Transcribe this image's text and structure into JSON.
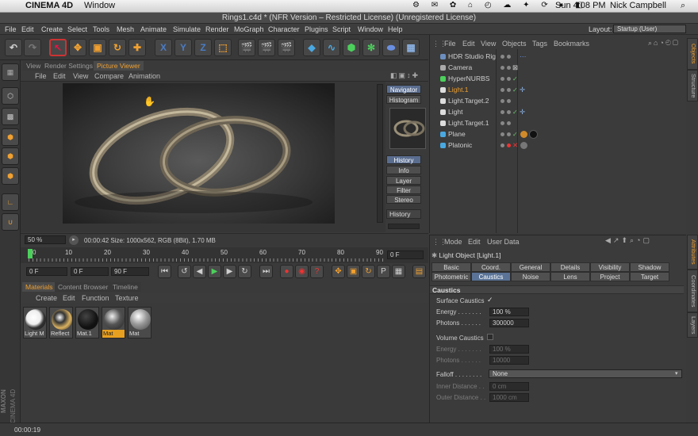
{
  "mac_menu": {
    "app": "CINEMA 4D",
    "window": "Window",
    "clock": "Sun 4:08 PM",
    "user": "Nick Campbell"
  },
  "window_title": "Rings1.c4d * (NFR Version – Restricted License) (Unregistered License)",
  "menu": [
    "File",
    "Edit",
    "Create",
    "Select",
    "Tools",
    "Mesh",
    "Animate",
    "Simulate",
    "Render",
    "MoGraph",
    "Character",
    "Plugins",
    "Script",
    "Window",
    "Help"
  ],
  "layout": {
    "label": "Layout:",
    "value": "Startup (User)"
  },
  "viewer": {
    "tabs": [
      "View",
      "Render Settings",
      "Picture Viewer"
    ],
    "menu": [
      "File",
      "Edit",
      "View",
      "Compare",
      "Animation"
    ],
    "side": [
      "Navigator",
      "Histogram"
    ],
    "side2": [
      "History",
      "Info",
      "Layer",
      "Filter",
      "Stereo"
    ],
    "history_label": "History",
    "zoom": "50 %",
    "status": "00:00:42  Size: 1000x562, RGB (8Bit), 1.70 MB"
  },
  "timeline": {
    "ticks": [
      "0",
      "10",
      "20",
      "30",
      "40",
      "50",
      "60",
      "70",
      "80",
      "90"
    ],
    "frame_end_right": "0 F",
    "start": "0 F",
    "current": "0 F",
    "end": "90 F"
  },
  "materials": {
    "tabs": [
      "Materials",
      "Content Browser",
      "Timeline"
    ],
    "menu": [
      "Create",
      "Edit",
      "Function",
      "Texture"
    ],
    "items": [
      {
        "name": "Light M",
        "c": "#eee"
      },
      {
        "name": "Reflect",
        "c": "#222"
      },
      {
        "name": "Mat.1",
        "c": "#111"
      },
      {
        "name": "Mat",
        "c": "#555"
      },
      {
        "name": "Mat",
        "c": "#888"
      }
    ]
  },
  "objects": {
    "menu": [
      "File",
      "Edit",
      "View",
      "Objects",
      "Tags",
      "Bookmarks"
    ],
    "rows": [
      {
        "name": "HDR Studio Rig",
        "hl": false
      },
      {
        "name": "Camera",
        "hl": false
      },
      {
        "name": "HyperNURBS",
        "hl": false
      },
      {
        "name": "Light.1",
        "hl": true
      },
      {
        "name": "Light.Target.2",
        "hl": false
      },
      {
        "name": "Light",
        "hl": false
      },
      {
        "name": "Light.Target.1",
        "hl": false
      },
      {
        "name": "Plane",
        "hl": false
      },
      {
        "name": "Platonic",
        "hl": false
      }
    ]
  },
  "attributes": {
    "menu": [
      "Mode",
      "Edit",
      "User Data"
    ],
    "title": "Light Object [Light.1]",
    "tabs_row1": [
      "Basic",
      "Coord.",
      "General",
      "Details",
      "Visibility",
      "Shadow"
    ],
    "tabs_row2": [
      "Photometric",
      "Caustics",
      "Noise",
      "Lens",
      "Project",
      "Target"
    ],
    "section": "Caustics",
    "surface_caustics": "Surface Caustics",
    "energy_label": "Energy . . . . . . .",
    "energy": "100 %",
    "photons_label": "Photons . . . . . .",
    "photons": "300000",
    "volume_caustics": "Volume Caustics",
    "v_energy_label": "Energy . . . . . . .",
    "v_energy": "100 %",
    "v_photons_label": "Photons . . . . . .",
    "v_photons": "10000",
    "falloff_label": "Falloff . . . . . . . .",
    "falloff": "None",
    "inner_label": "Inner Distance . .",
    "inner": "0 cm",
    "outer_label": "Outer Distance . .",
    "outer": "1000 cm"
  },
  "right_tabs": [
    "Objects",
    "Structure",
    "Attributes",
    "Coordinates",
    "Layers"
  ],
  "brand": {
    "maxon": "MAXON",
    "c4d": "CINEMA 4D"
  },
  "status_time": "00:00:19",
  "colors": {
    "accent": "#f0a030",
    "selected_tab": "#5a7396"
  }
}
